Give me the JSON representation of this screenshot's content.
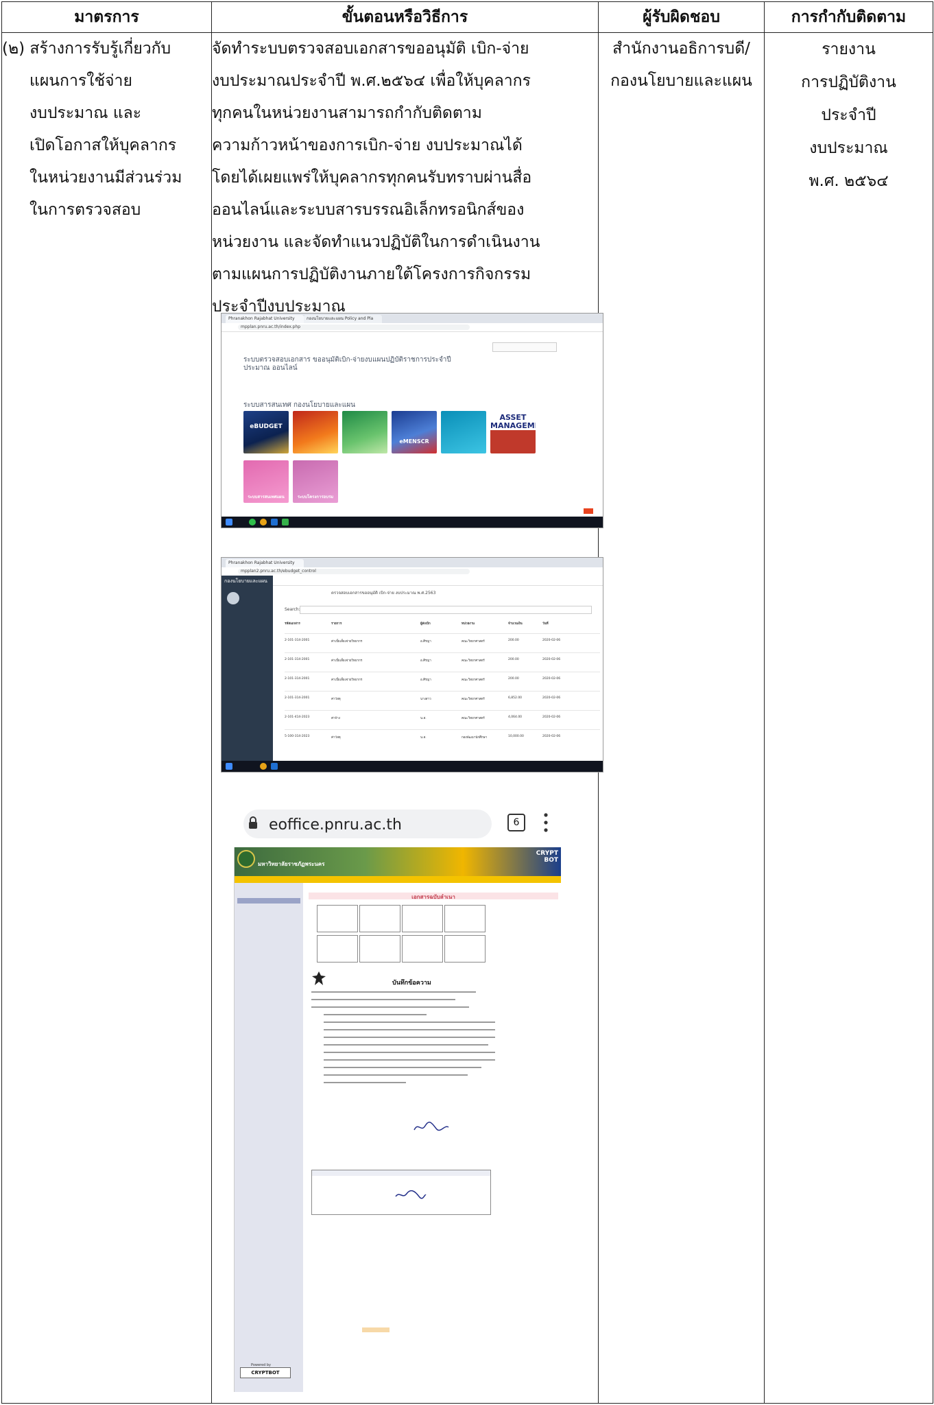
{
  "headers": {
    "measure": "มาตรการ",
    "procedure": "ขั้นตอนหรือวิธีการ",
    "responsible": "ผู้รับผิดชอบ",
    "monitoring": "การกำกับติดตาม"
  },
  "measure_lines": [
    "(๒) สร้างการรับรู้เกี่ยวกับ",
    "แผนการใช้จ่าย",
    "งบประมาณ และ",
    "เปิดโอกาสให้บุคลากร",
    "ในหน่วยงานมีส่วนร่วม",
    "ในการตรวจสอบ"
  ],
  "procedure_lines": [
    "จัดทำระบบตรวจสอบเอกสารขออนุมัติ เบิก-จ่าย",
    "งบประมาณประจำปี พ.ศ.๒๕๖๔ เพื่อให้บุคลากร",
    "ทุกคนในหน่วยงานสามารถกำกับติดตาม",
    "ความก้าวหน้าของการเบิก-จ่าย งบประมาณได้",
    "โดยได้เผยแพร่ให้บุคลากรทุกคนรับทราบผ่านสื่อ",
    "ออนไลน์และระบบสารบรรณอิเล็กทรอนิกส์ของ",
    "หน่วยงาน และจัดทำแนวปฏิบัติในการดำเนินงาน",
    "ตามแผนการปฏิบัติงานภายใต้โครงการกิจกรรม",
    "ประจำปีงบประมาณ"
  ],
  "responsible_lines": [
    "สำนักงานอธิการบดี/",
    "กองนโยบายและแผน"
  ],
  "monitoring_lines": [
    "รายงาน",
    "การปฏิบัติงาน",
    "ประจำปี",
    "งบประมาณ",
    "พ.ศ. ๒๕๖๔"
  ],
  "screenshot1": {
    "tab1": "Phranakhon Rajabhat University",
    "tab2": "กองนโยบายและแผน Policy and Pla",
    "url": "mpplan.pnru.ac.th/index.php",
    "section_left": "ระบบตรวจสอบเอกสาร ขออนุมัติเบิก-จ่ายงบ",
    "section_left2": "ประมาณ ออนไลน์",
    "section_right": "แผนปฏิบัติราชการประจำปี",
    "section_bottom": "ระบบสารสนเทศ กองนโยบายและแผน",
    "tiles": [
      "eBUDGET",
      "",
      "",
      "eMENSCR",
      "",
      "ASSET MANAGEMENT"
    ],
    "tiles2": [
      "ระบบสารสนเทศแผน",
      "ระบบโครงการอบรม"
    ]
  },
  "screenshot2": {
    "url": "mpplan2.pnru.ac.th/ebudget_control",
    "sidebar_title": "กองนโยบายและแผน",
    "page_title": "ตรวจสอบเอกสารขออนุมัติ เบิก-จ่าย งบประมาณ พ.ศ.2563",
    "search_label": "Search:",
    "columns": [
      "รหัสเอกสาร",
      "รายการ",
      "ผู้ส่งเบิก",
      "หน่วยงาน",
      "จำนวนเงิน",
      "วันที่"
    ],
    "rows": [
      [
        "2-101-314-2001",
        "ค่าเบี้ยเลี้ยงจ่ายวิทยากร",
        "อ.ศิรญา",
        "คณะวิทยาศาสตร์",
        "200.00",
        "2020-02-06"
      ],
      [
        "2-101-314-2001",
        "ค่าเบี้ยเลี้ยงจ่ายวิทยากร",
        "อ.ศิรญา",
        "คณะวิทยาศาสตร์",
        "200.00",
        "2020-02-06"
      ],
      [
        "2-101-314-2001",
        "ค่าเบี้ยเลี้ยงจ่ายวิทยากร",
        "อ.ศิรญา",
        "คณะวิทยาศาสตร์",
        "200.00",
        "2020-02-06"
      ],
      [
        "2-101-314-2001",
        "ค่าวัสดุ",
        "นางสาว",
        "คณะวิทยาศาสตร์",
        "6,852.00",
        "2020-02-06"
      ],
      [
        "2-101-414-2023",
        "ค่าจ้าง",
        "น.ส.",
        "คณะวิทยาศาสตร์",
        "4,064.00",
        "2020-02-06"
      ],
      [
        "5-100-314-2023",
        "ค่าวัสดุ",
        "น.ส.",
        "กองพัฒนานักศึกษา",
        "10,000.00",
        "2020-02-06"
      ]
    ]
  },
  "phone": {
    "url": "eoffice.pnru.ac.th",
    "tab_count": "6",
    "site_title": "มหาวิทยาลัยราชภัฏพระนคร",
    "brand": "CRYPT BOT",
    "doc_heading": "เอกสารฉบับลำเนา",
    "memo_title": "บันทึกข้อความ",
    "powered_by": "Powered by",
    "footer_brand": "CRYPTBOT"
  }
}
